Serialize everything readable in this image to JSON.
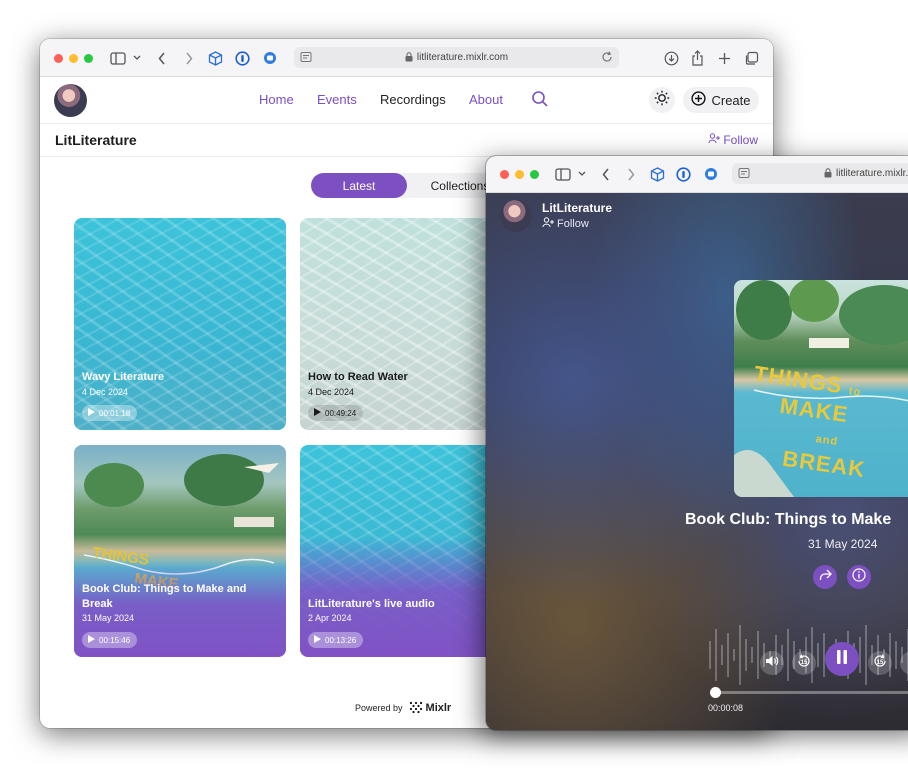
{
  "window1": {
    "url": "litliterature.mixlr.com",
    "nav": [
      {
        "label": "Home",
        "active": false
      },
      {
        "label": "Events",
        "active": false
      },
      {
        "label": "Recordings",
        "active": true
      },
      {
        "label": "About",
        "active": false
      }
    ],
    "create_label": "Create",
    "site_title": "LitLiterature",
    "follow_label": "Follow",
    "tabs": [
      {
        "label": "Latest",
        "selected": true
      },
      {
        "label": "Collections",
        "selected": false
      }
    ],
    "cards": [
      {
        "title": "Wavy Literature",
        "date": "4 Dec 2024",
        "duration": "00:01:18"
      },
      {
        "title": "How to Read Water",
        "date": "4 Dec 2024",
        "duration": "00:49:24"
      },
      {
        "title": "Book Club: Things to Make and Break",
        "date": "31 May 2024",
        "duration": "00:15:46"
      },
      {
        "title": "LitLiterature's live audio",
        "date": "2 Apr 2024",
        "duration": "00:13:26"
      }
    ],
    "powered_by": "Powered by",
    "brand": "Mixlr"
  },
  "window2": {
    "url": "litliterature.mixlr.com",
    "channel_name": "LitLiterature",
    "follow_label": "Follow",
    "artwork_text": [
      "THINGS",
      "to",
      "MAKE",
      "and",
      "BREAK"
    ],
    "episode_title": "Book Club: Things to Make",
    "episode_date": "31 May 2024",
    "elapsed": "00:00:08",
    "skip_seconds": "15"
  },
  "colors": {
    "accent": "#7d50c2",
    "nav_link": "#7a4fc4",
    "pool_blue": "#3ab6d2"
  }
}
